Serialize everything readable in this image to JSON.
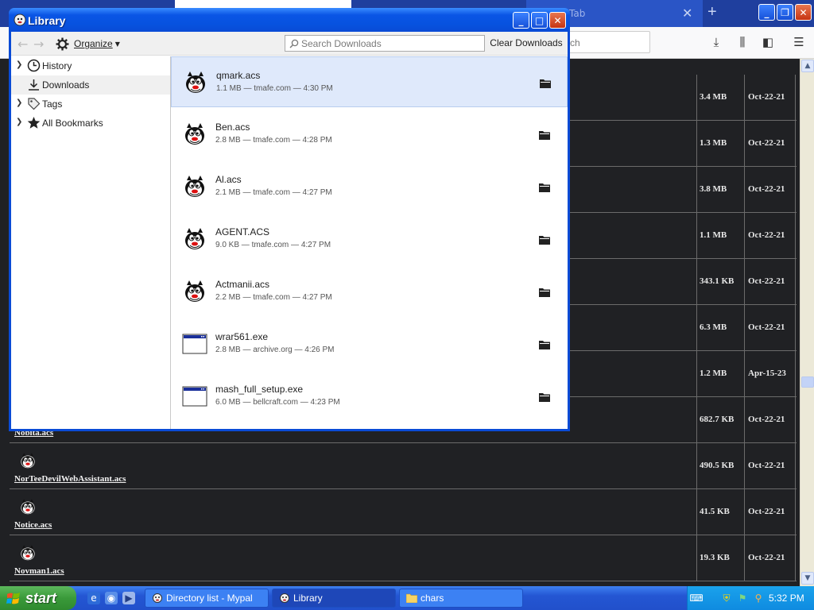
{
  "browser": {
    "new_tab_label": "Tab",
    "search_placeholder": "rch",
    "directory_rows": [
      {
        "name": "",
        "size": "3.4 MB",
        "date": "Oct-22-21"
      },
      {
        "name": "",
        "size": "1.3 MB",
        "date": "Oct-22-21"
      },
      {
        "name": "",
        "size": "3.8 MB",
        "date": "Oct-22-21"
      },
      {
        "name": "",
        "size": "1.1 MB",
        "date": "Oct-22-21"
      },
      {
        "name": "",
        "size": "343.1 KB",
        "date": "Oct-22-21"
      },
      {
        "name": "",
        "size": "6.3 MB",
        "date": "Oct-22-21"
      },
      {
        "name": "",
        "size": "1.2 MB",
        "date": "Apr-15-23"
      },
      {
        "name": "Nobita.acs",
        "size": "682.7 KB",
        "date": "Oct-22-21"
      },
      {
        "name": "NorTeeDevilWebAssistant.acs",
        "size": "490.5 KB",
        "date": "Oct-22-21"
      },
      {
        "name": "Notice.acs",
        "size": "41.5 KB",
        "date": "Oct-22-21"
      },
      {
        "name": "Novman1.acs",
        "size": "19.3 KB",
        "date": "Oct-22-21"
      }
    ]
  },
  "library": {
    "title": "Library",
    "organize_label": "Organize",
    "search_placeholder": "Search Downloads",
    "clear_label": "Clear Downloads",
    "sidebar": [
      {
        "label": "History",
        "icon": "clock-icon",
        "has_twisty": true
      },
      {
        "label": "Downloads",
        "icon": "download-icon",
        "has_twisty": false
      },
      {
        "label": "Tags",
        "icon": "tag-icon",
        "has_twisty": true
      },
      {
        "label": "All Bookmarks",
        "icon": "star-icon",
        "has_twisty": true
      }
    ],
    "downloads": [
      {
        "name": "qmark.acs",
        "meta": "1.1 MB — tmafe.com — 4:30 PM",
        "type": "agent"
      },
      {
        "name": "Ben.acs",
        "meta": "2.8 MB — tmafe.com — 4:28 PM",
        "type": "agent"
      },
      {
        "name": "Al.acs",
        "meta": "2.1 MB — tmafe.com — 4:27 PM",
        "type": "agent"
      },
      {
        "name": "AGENT.ACS",
        "meta": "9.0 KB — tmafe.com — 4:27 PM",
        "type": "agent"
      },
      {
        "name": "Actmanii.acs",
        "meta": "2.2 MB — tmafe.com — 4:27 PM",
        "type": "agent"
      },
      {
        "name": "wrar561.exe",
        "meta": "2.8 MB — archive.org — 4:26 PM",
        "type": "exe"
      },
      {
        "name": "mash_full_setup.exe",
        "meta": "6.0 MB — bellcraft.com — 4:23 PM",
        "type": "exe"
      }
    ]
  },
  "taskbar": {
    "start_label": "start",
    "tasks": [
      {
        "label": "Directory list - Mypal",
        "icon": "browser-icon"
      },
      {
        "label": "Library",
        "icon": "browser-icon"
      },
      {
        "label": "chars",
        "icon": "folder-icon"
      }
    ],
    "clock": "5:32 PM"
  }
}
